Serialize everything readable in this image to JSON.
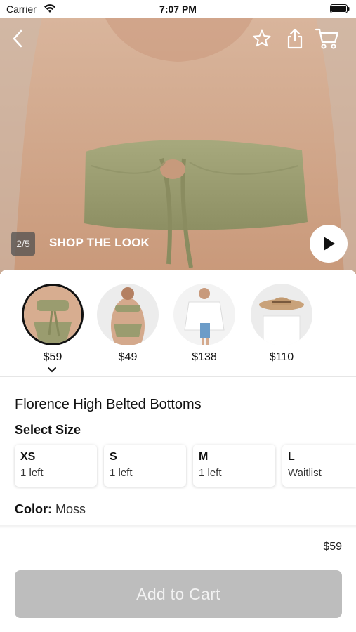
{
  "status_bar": {
    "carrier": "Carrier",
    "time": "7:07 PM"
  },
  "hero": {
    "icons": {
      "back": "back-arrow-icon",
      "favorite": "star-icon",
      "share": "share-icon",
      "cart": "cart-icon",
      "play": "play-icon"
    },
    "counter": "2/5",
    "shop_the_look": "SHOP THE LOOK"
  },
  "look_items": [
    {
      "price": "$59",
      "selected": true
    },
    {
      "price": "$49",
      "selected": false
    },
    {
      "price": "$138",
      "selected": false
    },
    {
      "price": "$110",
      "selected": false
    }
  ],
  "product": {
    "title": "Florence High Belted Bottoms",
    "select_size_label": "Select Size",
    "sizes": [
      {
        "name": "XS",
        "stock": "1 left"
      },
      {
        "name": "S",
        "stock": "1 left"
      },
      {
        "name": "M",
        "stock": "1 left"
      },
      {
        "name": "L",
        "stock": "Waitlist"
      }
    ],
    "color_label": "Color:",
    "color_value": "Moss"
  },
  "footer": {
    "price": "$59",
    "add_to_cart": "Add to Cart"
  },
  "colors": {
    "bikini": "#9a9c6f",
    "button_disabled": "#bdbdbd",
    "skin": "#d4a98c"
  }
}
